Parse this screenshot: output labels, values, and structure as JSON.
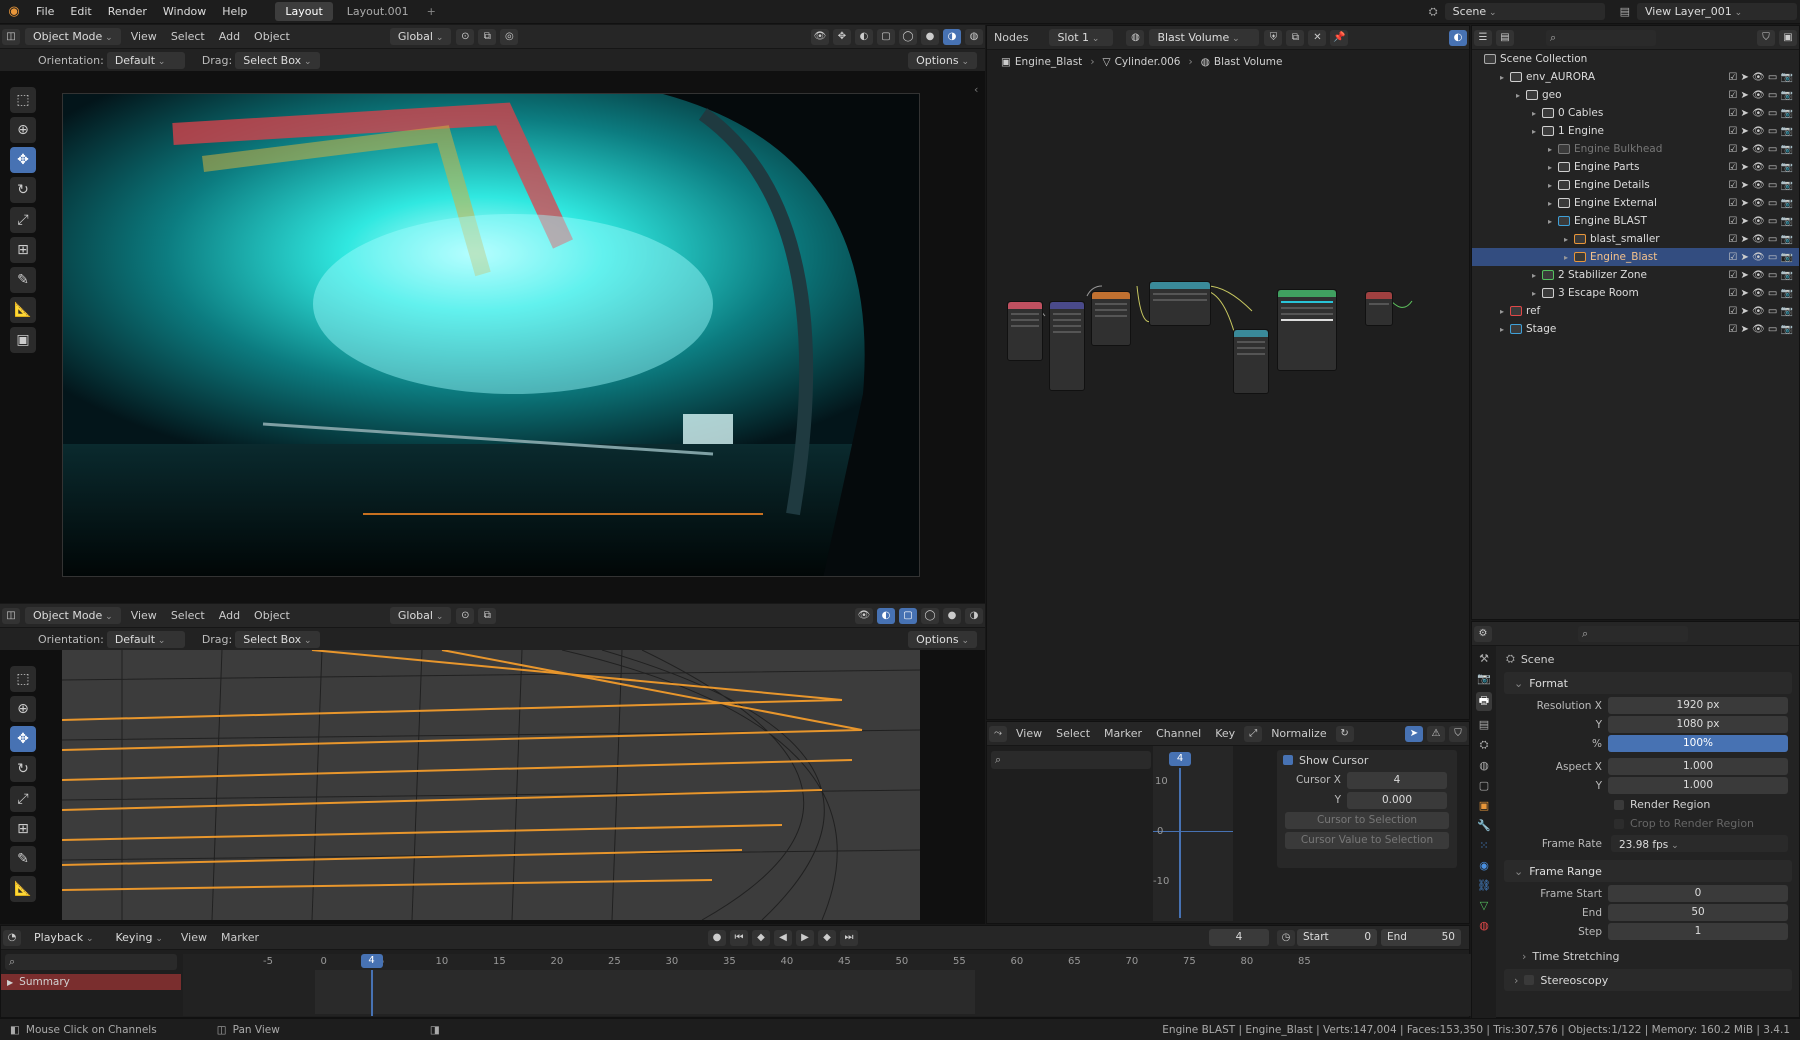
{
  "menubar": {
    "items": [
      "File",
      "Edit",
      "Render",
      "Window",
      "Help"
    ],
    "tabs": [
      "Layout",
      "Layout.001"
    ],
    "scene": "Scene",
    "view_layer": "View Layer_001"
  },
  "viewport": {
    "mode": "Object Mode",
    "menus": [
      "View",
      "Select",
      "Add",
      "Object"
    ],
    "transform": "Global",
    "orientation_label": "Orientation:",
    "orientation": "Default",
    "drag_label": "Drag:",
    "drag": "Select Box",
    "options": "Options"
  },
  "nodes": {
    "editor": "Nodes",
    "slot": "Slot 1",
    "material": "Blast Volume",
    "breadcrumb": [
      "Engine_Blast",
      "Cylinder.006",
      "Blast Volume"
    ]
  },
  "graph": {
    "menus": [
      "View",
      "Select",
      "Marker",
      "Channel",
      "Key"
    ],
    "normalize": "Normalize",
    "current_frame": "4",
    "show_cursor": "Show Cursor",
    "cursor_x_label": "Cursor X",
    "cursor_x": "4",
    "y_label": "Y",
    "cursor_y": "0.000",
    "btn_cursor_sel": "Cursor to Selection",
    "btn_cursor_val": "Cursor Value to Selection",
    "ticks": [
      "10",
      "0",
      "-10"
    ]
  },
  "outliner": {
    "root": "Scene Collection",
    "items": [
      {
        "label": "env_AURORA",
        "indent": 1,
        "col": "#cfcfcf"
      },
      {
        "label": "geo",
        "indent": 2,
        "col": "#cfcfcf"
      },
      {
        "label": "0 Cables",
        "indent": 3,
        "col": "#cfcfcf"
      },
      {
        "label": "1 Engine",
        "indent": 3,
        "col": "#cfcfcf"
      },
      {
        "label": "Engine Bulkhead",
        "indent": 4,
        "col": "#777",
        "dim": true
      },
      {
        "label": "Engine Parts",
        "indent": 4,
        "col": "#cfcfcf"
      },
      {
        "label": "Engine Details",
        "indent": 4,
        "col": "#cfcfcf"
      },
      {
        "label": "Engine External",
        "indent": 4,
        "col": "#cfcfcf"
      },
      {
        "label": "Engine BLAST",
        "indent": 4,
        "col": "#3fa0d8"
      },
      {
        "label": "blast_smaller",
        "indent": 5,
        "col": "#e8963a"
      },
      {
        "label": "Engine_Blast",
        "indent": 5,
        "col": "#e8963a",
        "sel": true
      },
      {
        "label": "2 Stabilizer Zone",
        "indent": 3,
        "col": "#55c060"
      },
      {
        "label": "3 Escape Room",
        "indent": 3,
        "col": "#cfcfcf"
      },
      {
        "label": "ref",
        "indent": 1,
        "col": "#e04848"
      },
      {
        "label": "Stage",
        "indent": 1,
        "col": "#3fa0d8"
      }
    ]
  },
  "properties": {
    "title": "Scene",
    "format": "Format",
    "res_x_label": "Resolution X",
    "res_x": "1920 px",
    "res_y_label": "Y",
    "res_y": "1080 px",
    "pct_label": "%",
    "pct": "100%",
    "aspect_x_label": "Aspect X",
    "aspect_x": "1.000",
    "aspect_y_label": "Y",
    "aspect_y": "1.000",
    "render_region": "Render Region",
    "crop": "Crop to Render Region",
    "frame_rate_label": "Frame Rate",
    "frame_rate": "23.98 fps",
    "frame_range": "Frame Range",
    "start_label": "Frame Start",
    "start": "0",
    "end_label": "End",
    "end": "50",
    "step_label": "Step",
    "step": "1",
    "time_stretching": "Time Stretching",
    "stereoscopy": "Stereoscopy"
  },
  "timeline": {
    "menus": [
      "Playback",
      "Keying",
      "View",
      "Marker"
    ],
    "current": "4",
    "start_label": "Start",
    "start": "0",
    "end_label": "End",
    "end": "50",
    "summary": "Summary",
    "ticks": [
      "-5",
      "0",
      "5",
      "10",
      "15",
      "20",
      "25",
      "30",
      "35",
      "40",
      "45",
      "50",
      "55",
      "60",
      "65",
      "70",
      "75",
      "80",
      "85"
    ]
  },
  "status": {
    "left": "Mouse Click on Channels",
    "mid": "Pan View",
    "right": "Engine BLAST | Engine_Blast | Verts:147,004 | Faces:153,350 | Tris:307,576 | Objects:1/122 | Memory: 160.2 MiB | 3.4.1"
  }
}
